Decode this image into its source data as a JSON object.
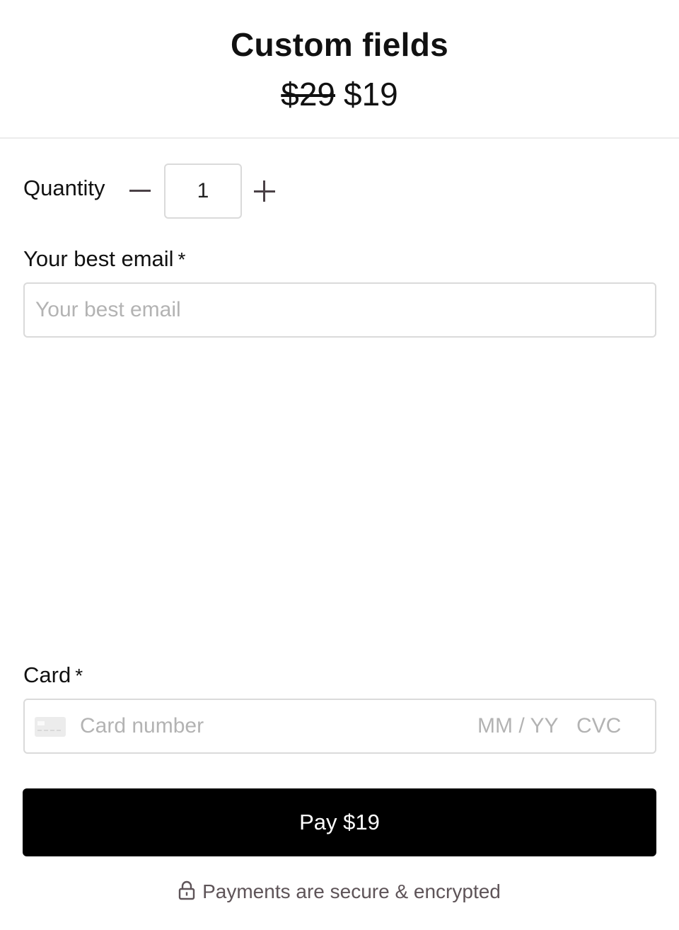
{
  "header": {
    "title": "Custom fields",
    "price_original": "$29",
    "price_current": "$19"
  },
  "quantity": {
    "label": "Quantity",
    "value": "1"
  },
  "email": {
    "label": "Your best email",
    "required_mark": "*",
    "placeholder": "Your best email"
  },
  "card": {
    "label": "Card",
    "required_mark": "*",
    "number_placeholder": "Card number",
    "expiry_placeholder": "MM / YY",
    "cvc_placeholder": "CVC",
    "icon": "credit-card-icon"
  },
  "pay_button": {
    "label": "Pay $19"
  },
  "footer": {
    "secure_text": "Payments are secure & encrypted",
    "icon": "lock-icon"
  },
  "colors": {
    "button_bg": "#000000",
    "button_text": "#ffffff",
    "muted_text": "#5e5458",
    "placeholder": "#b3b3b3",
    "border": "#dadada"
  }
}
